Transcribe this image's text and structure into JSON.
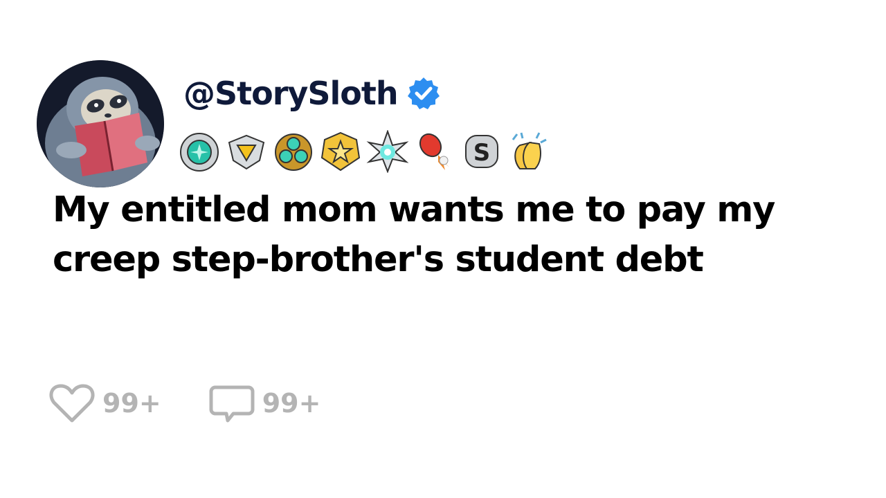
{
  "post": {
    "username": "@StorySloth",
    "verified": true,
    "badges": [
      {
        "icon": "teal-gem-medal-icon"
      },
      {
        "icon": "gold-heart-shield-icon"
      },
      {
        "icon": "tri-gem-crest-icon"
      },
      {
        "icon": "gold-star-badge-icon"
      },
      {
        "icon": "crystal-burst-icon"
      },
      {
        "icon": "rocket-launch-icon"
      },
      {
        "icon": "silver-s-token-icon"
      },
      {
        "icon": "clapping-hands-icon"
      }
    ],
    "title": "My entitled mom wants me to pay my creep step-brother's student debt"
  },
  "actions": {
    "likes_count": "99+",
    "comments_count": "99+"
  },
  "colors": {
    "username": "#0f1a3a",
    "verified": "#2d8ef0",
    "action_gray": "#b4b4b4"
  }
}
